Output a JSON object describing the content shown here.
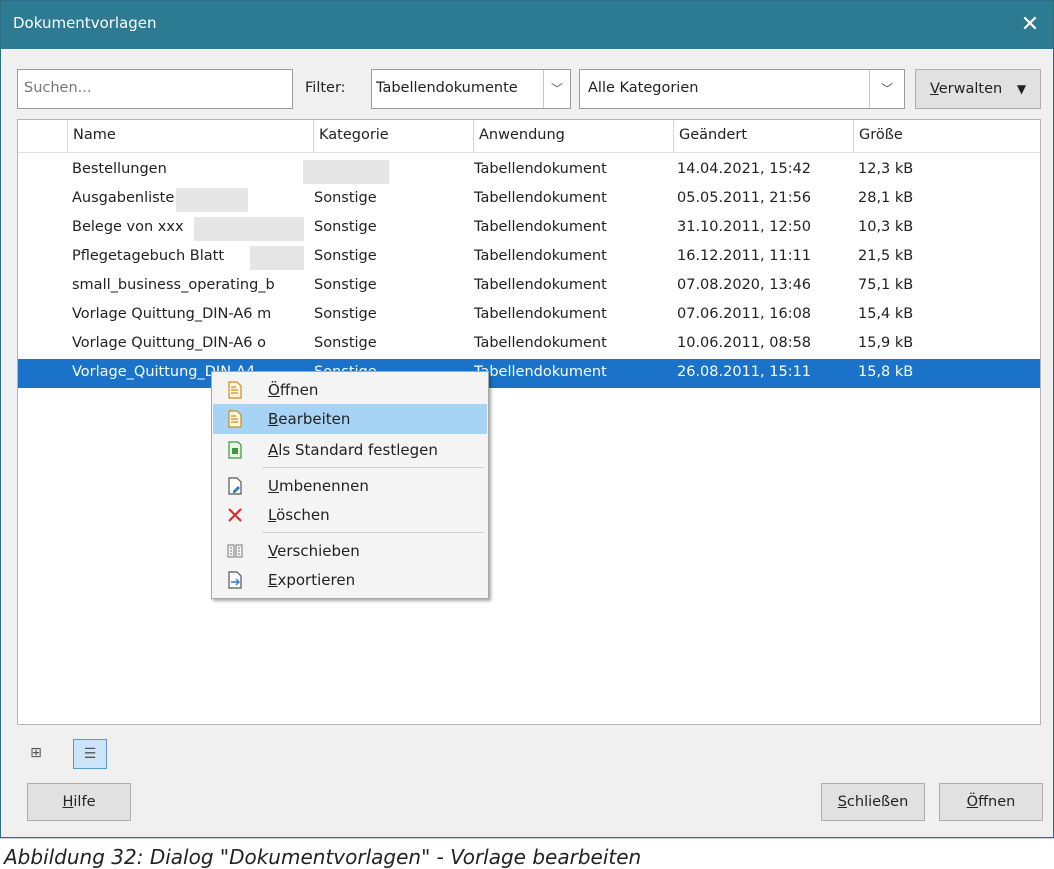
{
  "window": {
    "title": "Dokumentvorlagen",
    "close_glyph": "✕"
  },
  "toolbar": {
    "search_placeholder": "Suchen...",
    "filter_label": "Filter:",
    "filter_value": "Tabellendokumente",
    "category_value": "Alle Kategorien",
    "manage_first": "V",
    "manage_rest": "erwalten",
    "dropdown_glyph": "﹀",
    "manage_arrow": "▼"
  },
  "table": {
    "headers": [
      "Name",
      "Kategorie",
      "Anwendung",
      "Geändert",
      "Größe"
    ],
    "rows": [
      [
        "Bestellungen",
        "",
        "Tabellendokument",
        "14.04.2021, 15:42",
        "12,3 kB"
      ],
      [
        "Ausgabenliste",
        "Sonstige",
        "Tabellendokument",
        "05.05.2011, 21:56",
        "28,1 kB"
      ],
      [
        "Belege von xxx",
        "Sonstige",
        "Tabellendokument",
        "31.10.2011, 12:50",
        "10,3 kB"
      ],
      [
        "Pflegetagebuch Blatt",
        "Sonstige",
        "Tabellendokument",
        "16.12.2011, 11:11",
        "21,5 kB"
      ],
      [
        "small_business_operating_b",
        "Sonstige",
        "Tabellendokument",
        "07.08.2020, 13:46",
        "75,1 kB"
      ],
      [
        "Vorlage Quittung_DIN-A6 m",
        "Sonstige",
        "Tabellendokument",
        "07.06.2011, 16:08",
        "15,4 kB"
      ],
      [
        "Vorlage Quittung_DIN-A6 o",
        "Sonstige",
        "Tabellendokument",
        "10.06.2011, 08:58",
        "15,9 kB"
      ],
      [
        "Vorlage_Quittung_DIN-A4",
        "Sonstige",
        "Tabellendokument",
        "26.08.2011, 15:11",
        "15,8 kB"
      ]
    ],
    "selected_row": 7
  },
  "context_menu": {
    "items": [
      {
        "first": "Ö",
        "rest": "ffnen",
        "icon": "open-template-icon"
      },
      {
        "first": "B",
        "rest": "earbeiten",
        "icon": "edit-template-icon",
        "highlighted": true
      },
      {
        "first": "A",
        "rest": "ls Standard festlegen",
        "icon": "set-default-icon"
      },
      {
        "first": "U",
        "rest": "mbenennen",
        "icon": "rename-icon"
      },
      {
        "first": "L",
        "rest": "öschen",
        "icon": "delete-icon"
      },
      {
        "first": "V",
        "rest": "erschieben",
        "icon": "move-icon"
      },
      {
        "first": "E",
        "rest": "xportieren",
        "icon": "export-icon"
      }
    ]
  },
  "bottom": {
    "help_first": "H",
    "help_rest": "ilfe",
    "close_first": "S",
    "close_rest": "chließen",
    "open_first": "Ö",
    "open_rest": "ffnen",
    "thumbnail_glyph": "⊞",
    "list_glyph": "☰"
  },
  "caption": "Abbildung 32: Dialog \"Dokumentvorlagen\" - Vorlage bearbeiten",
  "colors": {
    "titlebar": "#2d7a93",
    "selection": "#1a73c8",
    "menu_highlight": "#a7d3f5",
    "delete_red": "#e02424"
  }
}
